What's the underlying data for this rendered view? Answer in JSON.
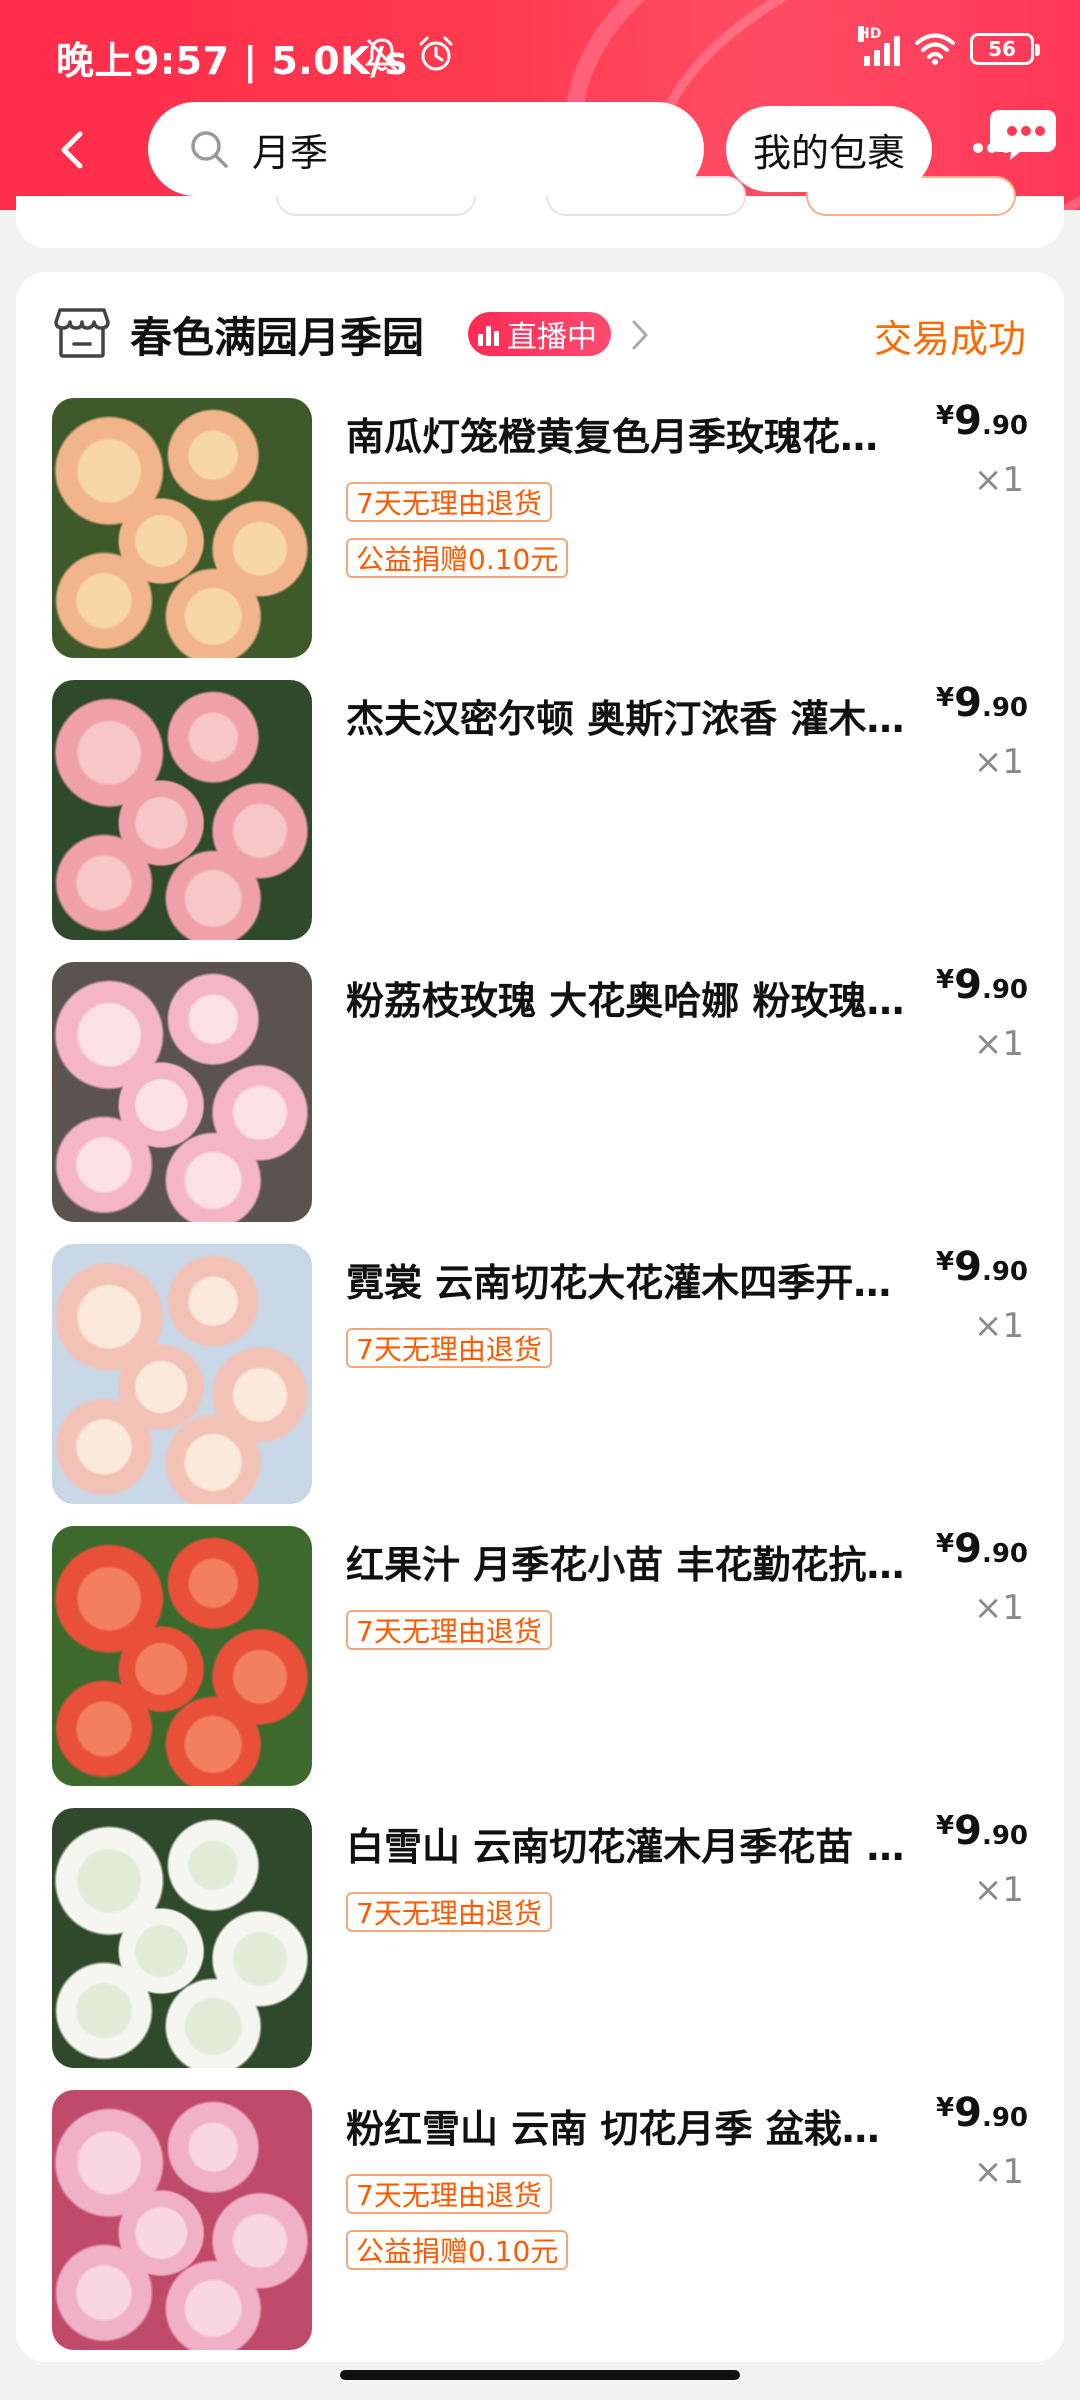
{
  "status_bar": {
    "time": "晚上9:57 | 5.0K/s",
    "network_label": "HD",
    "battery": "56"
  },
  "header": {
    "search_query": "月季",
    "parcel_button": "我的包裹",
    "icons": [
      "back-icon",
      "search-icon",
      "chat-more-icon"
    ]
  },
  "order": {
    "shop_name": "春色满园月季园",
    "live_badge": "直播中",
    "status": "交易成功",
    "items": [
      {
        "title": "南瓜灯笼橙黄复色月季玫瑰花…",
        "price_currency": "¥",
        "price_int": "9",
        "price_dec": ".90",
        "qty": "×1",
        "tags": [
          "7天无理由退货",
          "公益捐赠0.10元"
        ],
        "image_colors": [
          "#f2b48a",
          "#f7d7a8",
          "#3e5a2a"
        ]
      },
      {
        "title": "杰夫汉密尔顿 奥斯汀浓香 灌木…",
        "price_currency": "¥",
        "price_int": "9",
        "price_dec": ".90",
        "qty": "×1",
        "tags": [],
        "image_colors": [
          "#f0a0a8",
          "#f6c6c8",
          "#2f4a2a"
        ]
      },
      {
        "title": "粉荔枝玫瑰 大花奥哈娜 粉玫瑰…",
        "price_currency": "¥",
        "price_int": "9",
        "price_dec": ".90",
        "qty": "×1",
        "tags": [],
        "image_colors": [
          "#f4b6c6",
          "#fbe0e8",
          "#5a5350"
        ]
      },
      {
        "title": "霓裳 云南切花大花灌木四季开…",
        "price_currency": "¥",
        "price_int": "9",
        "price_dec": ".90",
        "qty": "×1",
        "tags": [
          "7天无理由退货"
        ],
        "image_colors": [
          "#f3c2b6",
          "#fbe9dc",
          "#c8d6e6"
        ]
      },
      {
        "title": "红果汁 月季花小苗 丰花勤花抗…",
        "price_currency": "¥",
        "price_int": "9",
        "price_dec": ".90",
        "qty": "×1",
        "tags": [
          "7天无理由退货"
        ],
        "image_colors": [
          "#e8503a",
          "#f28060",
          "#3d6a2c"
        ]
      },
      {
        "title": "白雪山 云南切花灌木月季花苗 …",
        "price_currency": "¥",
        "price_int": "9",
        "price_dec": ".90",
        "qty": "×1",
        "tags": [
          "7天无理由退货"
        ],
        "image_colors": [
          "#f4f6ef",
          "#e2ead8",
          "#2f4a2a"
        ]
      },
      {
        "title": "粉红雪山 云南 切花月季 盆栽…",
        "price_currency": "¥",
        "price_int": "9",
        "price_dec": ".90",
        "qty": "×1",
        "tags": [
          "7天无理由退货",
          "公益捐赠0.10元"
        ],
        "image_colors": [
          "#f0b0c6",
          "#f8d6e2",
          "#c04a6a"
        ]
      }
    ]
  },
  "colors": {
    "header_red": "#ff2c4a",
    "accent_orange": "#ff6a00",
    "tag_orange": "#ff5a00"
  }
}
